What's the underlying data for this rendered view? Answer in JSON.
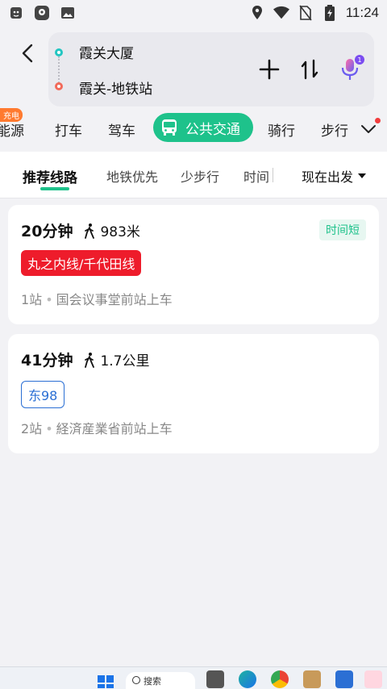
{
  "status_bar": {
    "time": "11:24"
  },
  "route": {
    "origin": "霞关大厦",
    "destination": "霞关-地铁站",
    "mic_badge": "1"
  },
  "modes": {
    "partial_left": "能源",
    "promo": "充电",
    "taxi": "打车",
    "drive": "驾车",
    "transit": "公共交通",
    "bike": "骑行",
    "walk": "步行"
  },
  "filters": {
    "recommended": "推荐线路",
    "subway_first": "地铁优先",
    "less_walking": "少步行",
    "time_partial": "时间",
    "depart": "现在出发"
  },
  "routes": [
    {
      "duration": "20分钟",
      "walk_distance": "983米",
      "tag": "时间短",
      "line": "丸之内线/千代田线",
      "line_color": "#ee1c2b",
      "stops": "1站",
      "boarding": "国会议事堂前站上车"
    },
    {
      "duration": "41分钟",
      "walk_distance": "1.7公里",
      "line": "东98",
      "line_color": "#2b6fd4",
      "stops": "2站",
      "boarding": "経済産業省前站上车"
    }
  ],
  "taskbar": {
    "search_label": "搜索"
  },
  "colors": {
    "accent": "#1ec28b",
    "start_dot": "#23c6c2",
    "end_dot": "#f26a5a"
  }
}
